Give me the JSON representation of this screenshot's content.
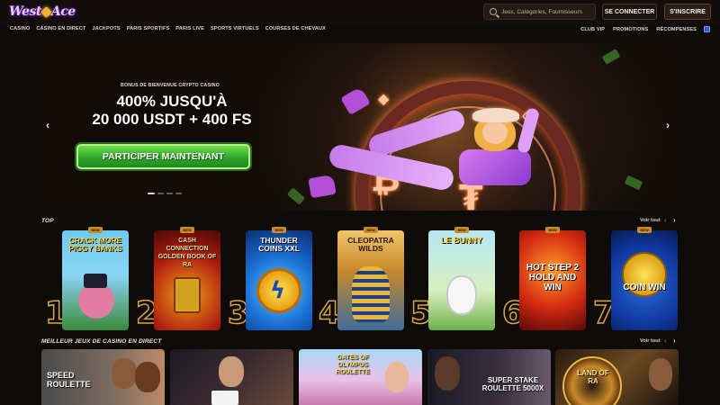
{
  "header": {
    "logo_text_1": "West",
    "logo_text_2": "Ace",
    "search_placeholder": "Jeux, Catégories, Fournisseurs",
    "login_label": "SE CONNECTER",
    "signup_label": "S'INSCRIRE"
  },
  "nav": {
    "left": [
      "CASINO",
      "CASINO EN DIRECT",
      "JACKPOTS",
      "PARIS SPORTIFS",
      "PARIS LIVE",
      "SPORTS VIRTUELS",
      "COURSES DE CHEVAUX"
    ],
    "right": [
      "CLUB VIP",
      "PROMOTIONS",
      "RÉCOMPENSES"
    ]
  },
  "hero": {
    "badge": "BONUS DE BIENVENUE CRYPTO CASINO",
    "title_line1": "400% JUSQU'À",
    "title_line2": "20 000 USDT + 400 FS",
    "cta": "PARTICIPER MAINTENANT",
    "prev_arrow": "‹",
    "next_arrow": "›",
    "slide_count": 4,
    "active_slide": 1
  },
  "top_section": {
    "title": "TOP",
    "see_all": "Voir tout",
    "prev": "‹",
    "next": "›",
    "new_label": "NEW",
    "games": [
      {
        "rank": "1",
        "title": "CRACK MORE PIGGY BANKS"
      },
      {
        "rank": "2",
        "title": "CASH CONNECTION GOLDEN BOOK OF RA"
      },
      {
        "rank": "3",
        "title": "THUNDER COINS XXL"
      },
      {
        "rank": "4",
        "title": "CLEOPATRA WILDS"
      },
      {
        "rank": "5",
        "title": "LE BUNNY"
      },
      {
        "rank": "6",
        "title": "HOT STEP 2 HOLD AND WIN"
      },
      {
        "rank": "7",
        "title": "COIN WIN"
      }
    ]
  },
  "live_section": {
    "title": "MEILLEUR JEUX DE CASINO EN DIRECT",
    "see_all": "Voir tout",
    "prev": "‹",
    "next": "›",
    "games": [
      {
        "title": "SPEED ROULETTE"
      },
      {
        "title": ""
      },
      {
        "title": "GATES OF OLYMPUS ROULETTE"
      },
      {
        "title": "SUPER STAKE ROULETTE 5000X"
      },
      {
        "title": "LAND OF RA"
      }
    ]
  },
  "colors": {
    "background": "#0e0b09",
    "cta_green": "#2fa52a",
    "rank_gold": "#d8a64a",
    "new_badge": "#c98b2a"
  }
}
